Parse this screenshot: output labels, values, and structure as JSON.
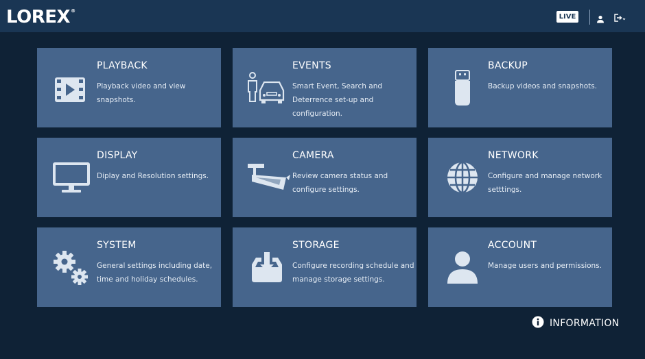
{
  "header": {
    "logo": "LOREX",
    "logo_mark": "®",
    "live_label": "LIVE",
    "user_icon": "user-icon",
    "logout_icon": "logout-icon"
  },
  "tiles": [
    {
      "title": "PLAYBACK",
      "desc": "Playback video and view snapshots.",
      "icon": "film-play-icon"
    },
    {
      "title": "EVENTS",
      "desc": "Smart Event, Search and Deterrence set-up and configuration.",
      "icon": "person-car-icon"
    },
    {
      "title": "BACKUP",
      "desc": "Backup videos and snapshots.",
      "icon": "usb-drive-icon"
    },
    {
      "title": "DISPLAY",
      "desc": "Diplay and Resolution settings.",
      "icon": "monitor-icon"
    },
    {
      "title": "CAMERA",
      "desc": "Review camera status and configure settings.",
      "icon": "security-camera-icon"
    },
    {
      "title": "NETWORK",
      "desc": "Configure and manage network setttings.",
      "icon": "globe-icon"
    },
    {
      "title": "SYSTEM",
      "desc": "General settings including date, time and holiday schedules.",
      "icon": "gears-icon"
    },
    {
      "title": "STORAGE",
      "desc": "Configure recording schedule and manage storage settings.",
      "icon": "storage-download-icon"
    },
    {
      "title": "ACCOUNT",
      "desc": "Manage users and permissions.",
      "icon": "account-icon"
    }
  ],
  "footer": {
    "info_label": "INFORMATION",
    "info_icon": "info-icon"
  },
  "colors": {
    "background": "#0f2236",
    "topbar": "#1a3654",
    "tile": "#46658c",
    "icon": "#dde6f0"
  }
}
